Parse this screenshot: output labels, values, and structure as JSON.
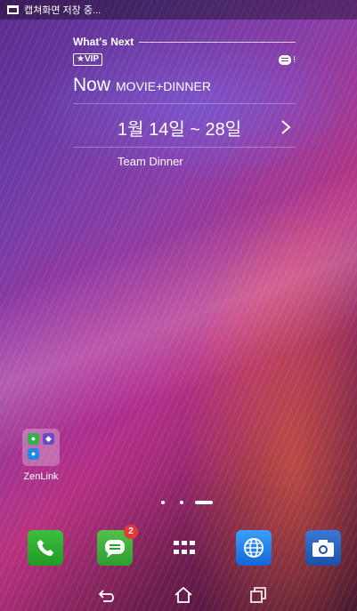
{
  "status_bar": {
    "notification_text": "캡쳐화면 저장 중...",
    "icon": "screenshot-icon"
  },
  "widget": {
    "section_title": "What's Next",
    "vip_label": "★VIP",
    "message_alert": "!",
    "now_label": "Now",
    "event_name": "MOVIE+DINNER",
    "date_range": "1월 14일 ~ 28일",
    "next_icon": "chevron-right-icon",
    "event_title": "Team Dinner"
  },
  "folder": {
    "label": "ZenLink",
    "apps": [
      "green-app-icon",
      "purple-app-icon",
      "blue-app-icon"
    ]
  },
  "page_indicator": {
    "pages": 3,
    "current": 3
  },
  "dock": {
    "apps": [
      {
        "name": "phone-icon"
      },
      {
        "name": "messaging-icon",
        "badge": "2"
      },
      {
        "name": "all-apps-icon"
      },
      {
        "name": "browser-icon"
      },
      {
        "name": "camera-icon"
      }
    ]
  },
  "navbar": {
    "buttons": [
      "back-icon",
      "home-icon",
      "recents-icon"
    ]
  },
  "colors": {
    "wallpaper_base": "#6b3aa4",
    "wallpaper_pink": "#b8327e",
    "badge_red": "#e53935",
    "phone_green": "#2aa72e",
    "browser_blue": "#1e88e5"
  }
}
